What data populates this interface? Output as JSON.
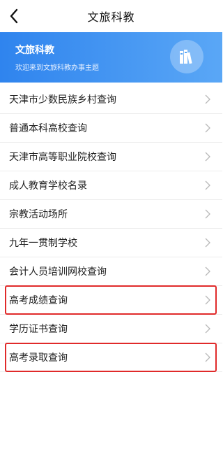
{
  "header": {
    "title": "文旅科教"
  },
  "banner": {
    "title": "文旅科教",
    "subtitle": "欢迎来到文旅科教办事主题"
  },
  "list": {
    "items": [
      {
        "label": "天津市少数民族乡村查询",
        "highlighted": false
      },
      {
        "label": "普通本科高校查询",
        "highlighted": false
      },
      {
        "label": "天津市高等职业院校查询",
        "highlighted": false
      },
      {
        "label": "成人教育学校名录",
        "highlighted": false
      },
      {
        "label": "宗教活动场所",
        "highlighted": false
      },
      {
        "label": "九年一贯制学校",
        "highlighted": false
      },
      {
        "label": "会计人员培训网校查询",
        "highlighted": false
      },
      {
        "label": "高考成绩查询",
        "highlighted": true
      },
      {
        "label": "学历证书查询",
        "highlighted": false
      },
      {
        "label": "高考录取查询",
        "highlighted": true
      }
    ]
  },
  "colors": {
    "banner_start": "#2f84ee",
    "banner_end": "#5aa7f6",
    "highlight_border": "#e02a2a"
  },
  "icons": {
    "back": "chevron-left-icon",
    "row": "chevron-right-icon",
    "banner": "books-emblem-icon"
  }
}
